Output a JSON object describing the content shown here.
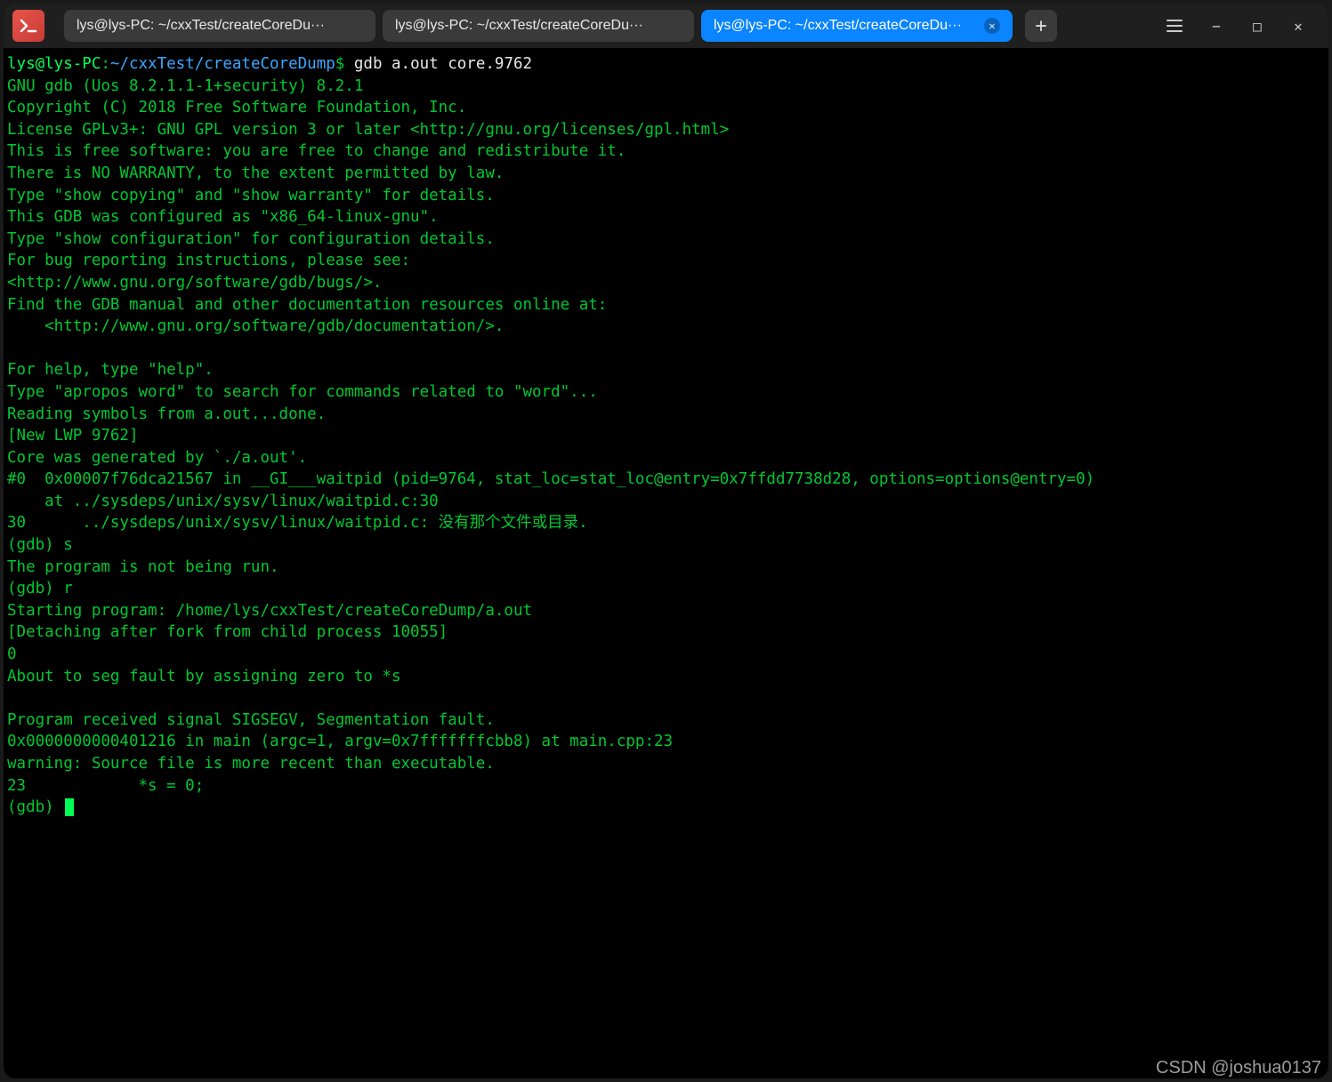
{
  "titlebar": {
    "tabs": [
      {
        "label": "lys@lys-PC: ~/cxxTest/createCoreDu···",
        "active": false
      },
      {
        "label": "lys@lys-PC: ~/cxxTest/createCoreDu···",
        "active": false
      },
      {
        "label": "lys@lys-PC: ~/cxxTest/createCoreDu···",
        "active": true
      }
    ],
    "new_tab_glyph": "+",
    "menu_icon": "hamburger",
    "minimize_icon": "−",
    "maximize_icon": "□",
    "close_icon": "✕"
  },
  "prompt": {
    "user_host": "lys@lys-PC",
    "sep": ":",
    "path": "~/cxxTest/createCoreDump",
    "command": "gdb a.out core.9762"
  },
  "terminal_lines": [
    "GNU gdb (Uos 8.2.1.1-1+security) 8.2.1",
    "Copyright (C) 2018 Free Software Foundation, Inc.",
    "License GPLv3+: GNU GPL version 3 or later <http://gnu.org/licenses/gpl.html>",
    "This is free software: you are free to change and redistribute it.",
    "There is NO WARRANTY, to the extent permitted by law.",
    "Type \"show copying\" and \"show warranty\" for details.",
    "This GDB was configured as \"x86_64-linux-gnu\".",
    "Type \"show configuration\" for configuration details.",
    "For bug reporting instructions, please see:",
    "<http://www.gnu.org/software/gdb/bugs/>.",
    "Find the GDB manual and other documentation resources online at:",
    "    <http://www.gnu.org/software/gdb/documentation/>.",
    "",
    "For help, type \"help\".",
    "Type \"apropos word\" to search for commands related to \"word\"...",
    "Reading symbols from a.out...done.",
    "[New LWP 9762]",
    "Core was generated by `./a.out'.",
    "#0  0x00007f76dca21567 in __GI___waitpid (pid=9764, stat_loc=stat_loc@entry=0x7ffdd7738d28, options=options@entry=0)",
    "    at ../sysdeps/unix/sysv/linux/waitpid.c:30",
    "30      ../sysdeps/unix/sysv/linux/waitpid.c: 没有那个文件或目录.",
    "(gdb) s",
    "The program is not being run.",
    "(gdb) r",
    "Starting program: /home/lys/cxxTest/createCoreDump/a.out",
    "[Detaching after fork from child process 10055]",
    "0",
    "About to seg fault by assigning zero to *s",
    "",
    "Program received signal SIGSEGV, Segmentation fault.",
    "0x0000000000401216 in main (argc=1, argv=0x7fffffffcbb8) at main.cpp:23",
    "warning: Source file is more recent than executable.",
    "23            *s = 0;",
    "(gdb) "
  ],
  "watermark": "CSDN @joshua0137"
}
